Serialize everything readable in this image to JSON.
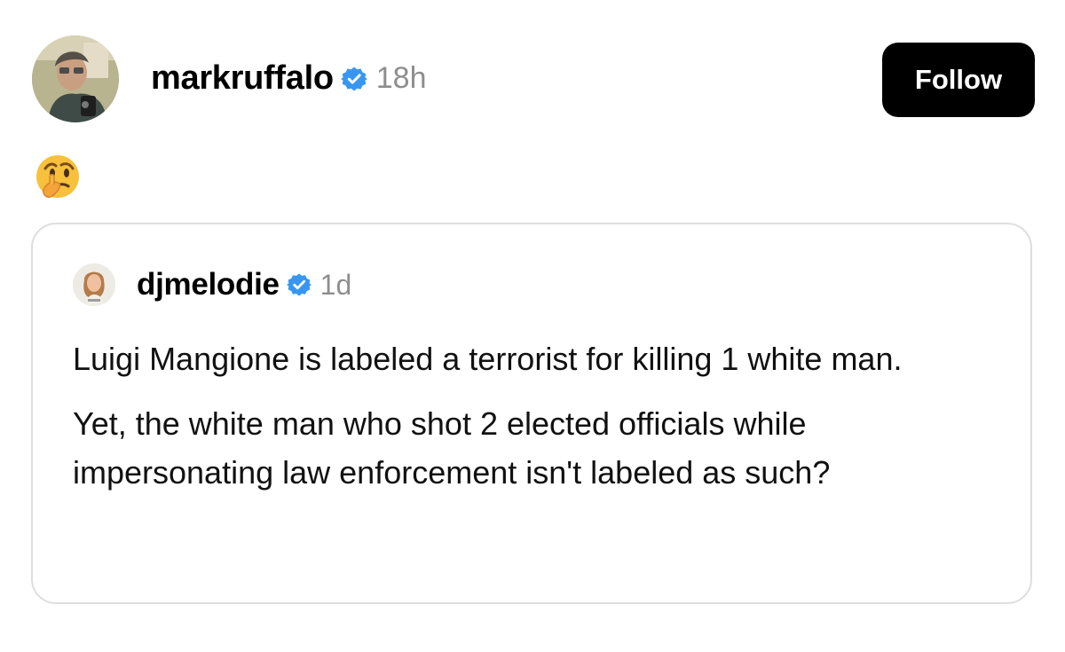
{
  "post": {
    "author": "markruffalo",
    "verified": true,
    "time": "18h",
    "follow_label": "Follow",
    "content_icon": "thinking-face-emoji"
  },
  "quote": {
    "author": "djmelodie",
    "verified": true,
    "time": "1d",
    "paragraphs": [
      "Luigi Mangione is labeled a terrorist for killing 1 white man.",
      "Yet, the white man who shot 2 elected officials while impersonating law enforcement isn't labeled as such?"
    ]
  },
  "colors": {
    "accent": "#3797f0",
    "button_bg": "#000000",
    "secondary_text": "#8e8e8e",
    "card_border": "#dedede"
  }
}
